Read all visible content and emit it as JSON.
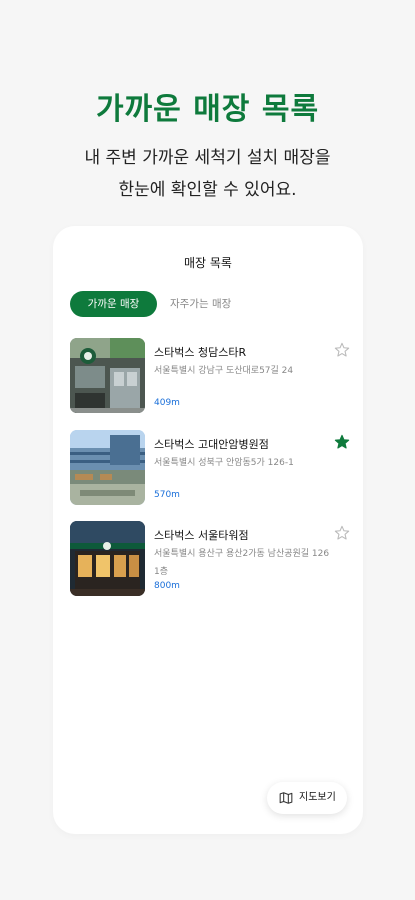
{
  "header": {
    "headline": "가까운 매장 목록",
    "subtext_line1": "내 주변 가까운 세척기 설치 매장을",
    "subtext_line2": "한눈에 확인할 수 있어요."
  },
  "card": {
    "title": "매장 목록",
    "tabs": [
      {
        "label": "가까운 매장",
        "active": true
      },
      {
        "label": "자주가는 매장",
        "active": false
      }
    ],
    "stores": [
      {
        "name": "스타벅스 청담스타R",
        "address": "서울특별시 강남구 도산대로57길 24",
        "distance": "409m",
        "favorite": false,
        "thumb_icon": "storefront-photo"
      },
      {
        "name": "스타벅스 고대안암병원점",
        "address": "서울특별시 성북구 안암동5가 126-1",
        "distance": "570m",
        "favorite": true,
        "thumb_icon": "storefront-photo"
      },
      {
        "name": "스타벅스 서울타워점",
        "address": "서울특별시 용산구 용산2가동 남산공원길 126 1층",
        "distance": "800m",
        "favorite": false,
        "thumb_icon": "storefront-photo"
      }
    ],
    "map_button": {
      "label": "지도보기",
      "icon": "map-icon"
    }
  },
  "colors": {
    "brand": "#0e7a3c",
    "distance": "#1a6fd9",
    "star_active": "#0e7a3c",
    "star_inactive": "#bbbbbb"
  }
}
